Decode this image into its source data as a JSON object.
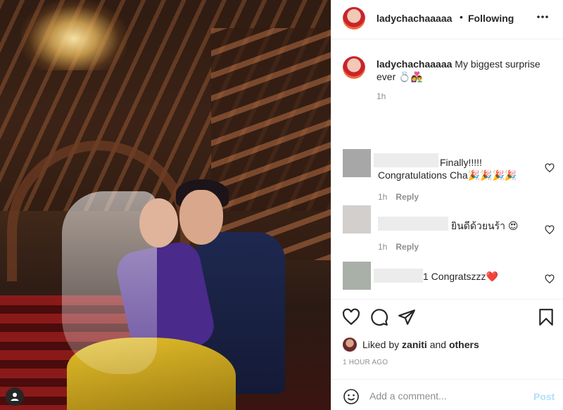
{
  "post": {
    "username": "ladychachaaaaa",
    "separator": "•",
    "follow_status": "Following",
    "more_icon": "ellipsis-icon"
  },
  "caption": {
    "username": "ladychachaaaaa",
    "text": "My biggest surprise ever 💍👩‍❤️‍👨",
    "time": "1h"
  },
  "comments": [
    {
      "text_line1": "Finally!!!!!",
      "text_line2": "Congratulations Cha🎉🎉🎉🎉",
      "time": "1h",
      "reply_label": "Reply"
    },
    {
      "text": "ยินดีด้วยนร้า 😍",
      "time": "1h",
      "reply_label": "Reply"
    },
    {
      "text": "1 Congratszzz❤️"
    }
  ],
  "likes": {
    "prefix": "Liked by",
    "user": "zaniti",
    "joiner": "and",
    "others": "others"
  },
  "timestamp": "1 HOUR AGO",
  "add_comment": {
    "placeholder": "Add a comment...",
    "post_label": "Post"
  },
  "colors": {
    "text": "#262626",
    "muted": "#8e8e8e",
    "post_disabled": "#b2dffc",
    "divider": "#efefef"
  }
}
